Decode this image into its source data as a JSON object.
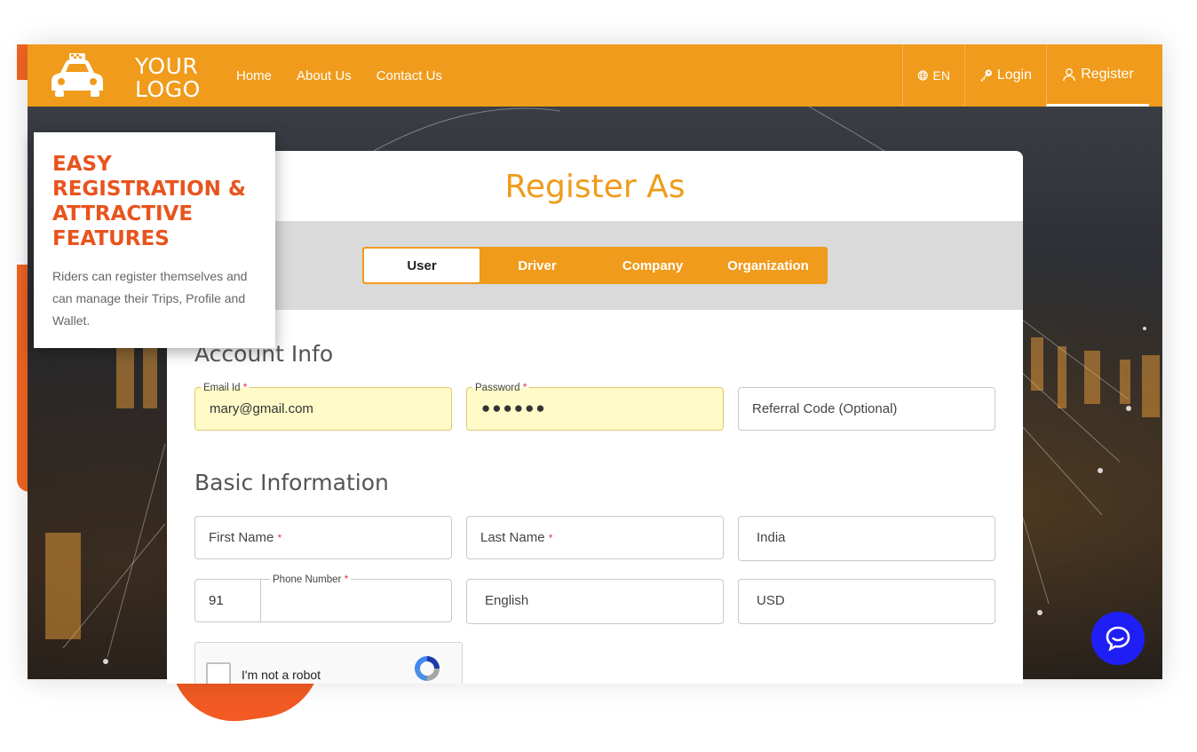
{
  "header": {
    "logo_text_line1": "YOUR",
    "logo_text_line2": "LOGO",
    "nav": [
      "Home",
      "About Us",
      "Contact Us"
    ],
    "language": "EN",
    "login_label": "Login",
    "register_label": "Register"
  },
  "promo": {
    "title": "EASY REGISTRATION & ATTRACTIVE FEATURES",
    "text": "Riders can register themselves and can manage their Trips, Profile and Wallet."
  },
  "card": {
    "title": "Register As",
    "tabs": [
      "User",
      "Driver",
      "Company",
      "Organization"
    ],
    "active_tab": "User"
  },
  "account_info": {
    "heading": "Account Info",
    "email_label": "Email Id",
    "email_value": "mary@gmail.com",
    "password_label": "Password",
    "password_value": "●●●●●●",
    "referral_placeholder": "Referral Code (Optional)"
  },
  "basic_info": {
    "heading": "Basic Information",
    "first_name_placeholder": "First Name",
    "last_name_placeholder": "Last Name",
    "country_value": "India",
    "phone_code": "91",
    "phone_label": "Phone Number",
    "language_value": "English",
    "currency_value": "USD"
  },
  "captcha": {
    "label": "I'm not a robot"
  },
  "required_mark": "*",
  "colors": {
    "brand_orange": "#f09b1b",
    "accent_red_orange": "#e8541e",
    "chat_blue": "#1f1ff5"
  }
}
